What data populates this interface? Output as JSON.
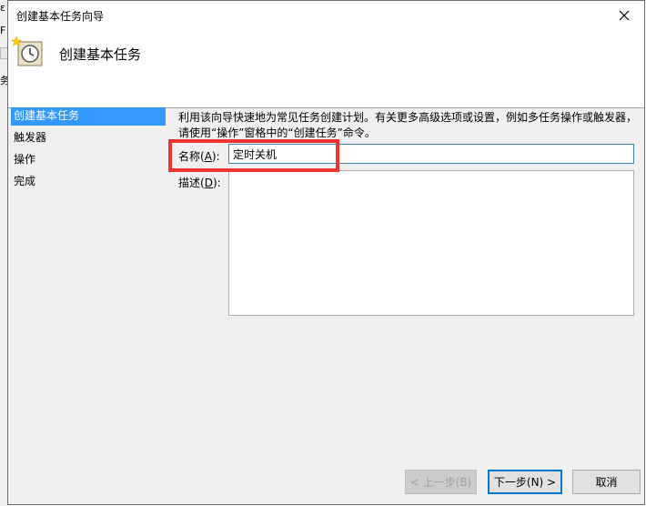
{
  "background_app": {
    "fragments": [
      "ε",
      "F",
      "务"
    ]
  },
  "window": {
    "title": "创建基本任务向导"
  },
  "header": {
    "title": "创建基本任务"
  },
  "nav": {
    "items": [
      "创建基本任务",
      "触发器",
      "操作",
      "完成"
    ],
    "active_index": 0
  },
  "description_text": "利用该向导快速地为常见任务创建计划。有关更多高级选项或设置，例如多任务操作或触发器，请使用“操作”窗格中的“创建任务”命令。",
  "form": {
    "name_label": "名称",
    "name_accel": "A",
    "name_value": "定时关机",
    "desc_label": "描述",
    "desc_accel": "D",
    "desc_value": ""
  },
  "buttons": {
    "back": "< 上一步(B)",
    "next": "下一步(N) >",
    "cancel": "取消"
  },
  "colors": {
    "highlight": "#ee3333",
    "accent": "#3399ff"
  }
}
